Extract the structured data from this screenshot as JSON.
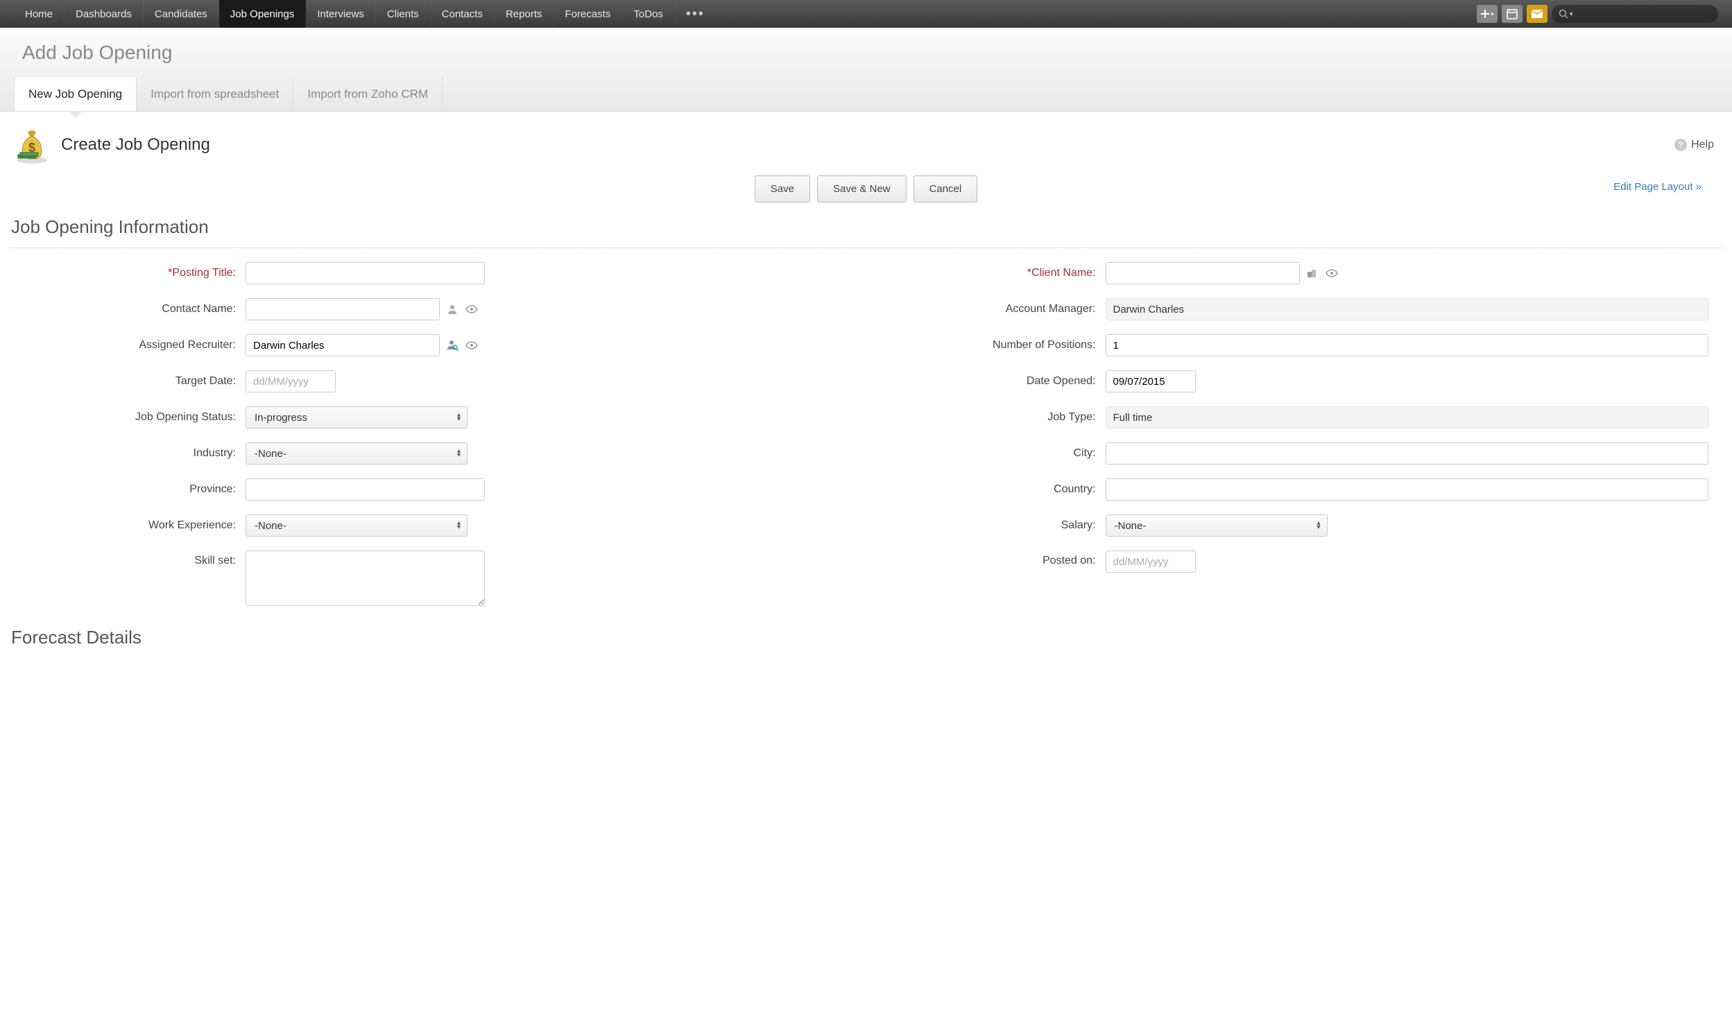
{
  "nav": {
    "items": [
      "Home",
      "Dashboards",
      "Candidates",
      "Job Openings",
      "Interviews",
      "Clients",
      "Contacts",
      "Reports",
      "Forecasts",
      "ToDos"
    ],
    "active_index": 3
  },
  "page_title_sub": "Add Job Opening",
  "sub_tabs": {
    "items": [
      "New Job Opening",
      "Import from spreadsheet",
      "Import from Zoho CRM"
    ],
    "active_index": 0
  },
  "page_heading": "Create Job Opening",
  "help_label": "Help",
  "actions": {
    "save": "Save",
    "save_new": "Save & New",
    "cancel": "Cancel",
    "edit_layout": "Edit Page Layout »"
  },
  "sections": {
    "info": "Job Opening Information",
    "forecast": "Forecast Details"
  },
  "labels": {
    "posting_title": "Posting Title:",
    "client_name": "Client Name:",
    "contact_name": "Contact Name:",
    "account_manager": "Account Manager:",
    "assigned_recruiter": "Assigned Recruiter:",
    "number_of_positions": "Number of Positions:",
    "target_date": "Target Date:",
    "date_opened": "Date Opened:",
    "job_opening_status": "Job Opening Status:",
    "job_type": "Job Type:",
    "industry": "Industry:",
    "city": "City:",
    "province": "Province:",
    "country": "Country:",
    "work_experience": "Work Experience:",
    "salary": "Salary:",
    "skill_set": "Skill set:",
    "posted_on": "Posted on:"
  },
  "values": {
    "posting_title": "",
    "client_name": "",
    "contact_name": "",
    "account_manager": "Darwin Charles",
    "assigned_recruiter": "Darwin Charles",
    "number_of_positions": "1",
    "target_date": "",
    "date_opened": "09/07/2015",
    "job_opening_status": "In-progress",
    "job_type": "Full time",
    "industry": "-None-",
    "city": "",
    "province": "",
    "country": "",
    "work_experience": "-None-",
    "salary": "-None-",
    "skill_set": "",
    "posted_on": ""
  },
  "placeholders": {
    "date": "dd/MM/yyyy"
  }
}
